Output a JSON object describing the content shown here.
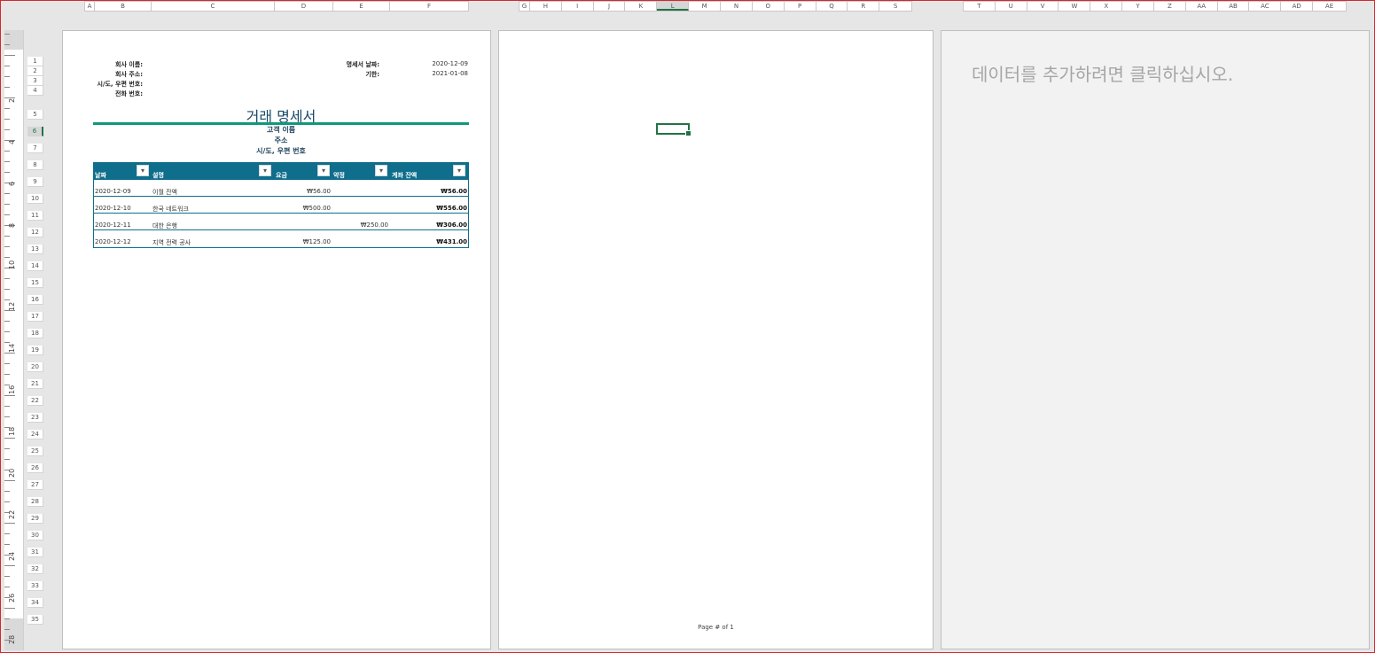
{
  "column_headers": {
    "group1": [
      "A",
      "B",
      "C",
      "D",
      "E",
      "F"
    ],
    "group2": [
      "G",
      "H",
      "I",
      "J",
      "K",
      "L",
      "M",
      "N",
      "O",
      "P",
      "Q",
      "R",
      "S"
    ],
    "group3": [
      "T",
      "U",
      "V",
      "W",
      "X",
      "Y",
      "Z",
      "AA",
      "AB",
      "AC",
      "AD",
      "AE"
    ],
    "selected": "L"
  },
  "ruler_numbers": [
    "2",
    "4",
    "6",
    "8",
    "10",
    "12",
    "14",
    "16",
    "18",
    "20",
    "22",
    "24",
    "26",
    "28"
  ],
  "row_numbers": [
    "1",
    "2",
    "3",
    "4",
    "5",
    "6",
    "7",
    "8",
    "9",
    "10",
    "11",
    "12",
    "13",
    "14",
    "15",
    "16",
    "17",
    "18",
    "19",
    "20",
    "21",
    "22",
    "23",
    "24",
    "25",
    "26",
    "27",
    "28",
    "29",
    "30",
    "31",
    "32",
    "33",
    "34",
    "35"
  ],
  "selected_row": "6",
  "invoice": {
    "company_name_label": "회사 이름:",
    "company_address_label": "회사 주소:",
    "city_zip_label": "시/도, 우편 번호:",
    "phone_label": "전화 번호:",
    "statement_date_label": "명세서 날짜:",
    "statement_date": "2020-12-09",
    "due_label": "기한:",
    "due_date": "2021-01-08",
    "title": "거래 명세서",
    "customer_name": "고객 이름",
    "customer_address": "주소",
    "customer_city_zip": "시/도, 우편 번호"
  },
  "table": {
    "headers": [
      "날짜",
      "설명",
      "요금",
      "약정",
      "계좌 잔액"
    ],
    "rows": [
      {
        "date": "2020-12-09",
        "description": "이월 잔액",
        "charge": "₩56.00",
        "payment": "",
        "balance": "₩56.00"
      },
      {
        "date": "2020-12-10",
        "description": "한국 네트워크",
        "charge": "₩500.00",
        "payment": "",
        "balance": "₩556.00"
      },
      {
        "date": "2020-12-11",
        "description": "대한 은행",
        "charge": "",
        "payment": "₩250.00",
        "balance": "₩306.00"
      },
      {
        "date": "2020-12-12",
        "description": "지역 전력 공사",
        "charge": "₩125.00",
        "payment": "",
        "balance": "₩431.00"
      }
    ]
  },
  "page2_footer": "Page # of 1",
  "page3_placeholder": "데이터를 추가하려면 클릭하십시오.",
  "colors": {
    "accent": "#0e6e8c",
    "rule": "#0e9a7a",
    "selection": "#217346",
    "frame": "#d8262b"
  },
  "icons": {
    "filter_dropdown": "chevron-down-icon"
  }
}
